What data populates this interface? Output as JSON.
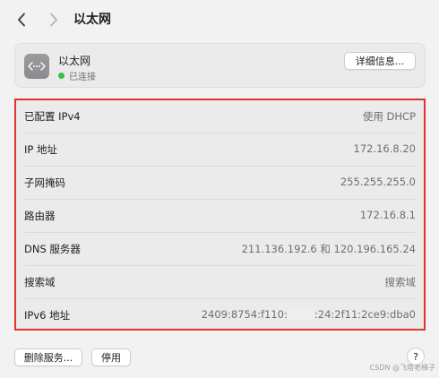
{
  "nav": {
    "title": "以太网",
    "back_icon": "chevron-left-icon",
    "forward_icon": "chevron-right-icon"
  },
  "header": {
    "icon": "ethernet-icon",
    "title": "以太网",
    "status": "已连接",
    "status_color": "#32c045",
    "details_button": "详细信息..."
  },
  "info": [
    {
      "label": "已配置 IPv4",
      "value": "使用 DHCP"
    },
    {
      "label": "IP 地址",
      "value": "172.16.8.20"
    },
    {
      "label": "子网掩码",
      "value": "255.255.255.0"
    },
    {
      "label": "路由器",
      "value": "172.16.8.1"
    },
    {
      "label": "DNS 服务器",
      "value": "211.136.192.6 和 120.196.165.24"
    },
    {
      "label": "搜索域",
      "value": "搜索域"
    },
    {
      "label": "IPv6 地址",
      "value_start": "2409:8754:f110:",
      "value_end": ":24:2f11:2ce9:dba0"
    }
  ],
  "highlight_color": "#e0352b",
  "footer": {
    "delete_button": "删除服务...",
    "disable_button": "停用",
    "help_button": "?"
  },
  "watermark": "CSDN @飞塔老梯子"
}
